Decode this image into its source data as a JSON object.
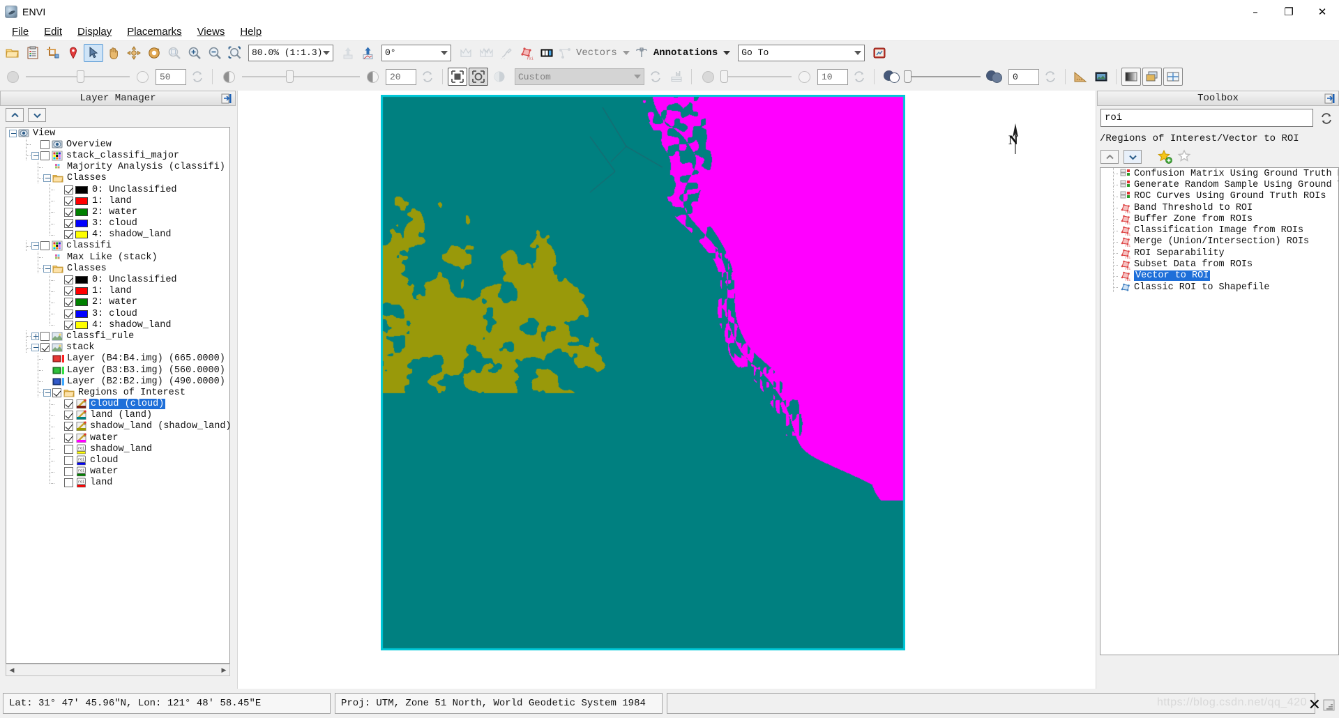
{
  "window": {
    "title": "ENVI",
    "app_icon": "envi-logo-icon",
    "minimize": "–",
    "maximize": "❐",
    "close": "✕"
  },
  "menubar": {
    "items": [
      {
        "label": "File",
        "mnemonic": "F"
      },
      {
        "label": "Edit",
        "mnemonic": "E"
      },
      {
        "label": "Display",
        "mnemonic": "D"
      },
      {
        "label": "Placemarks",
        "mnemonic": "P"
      },
      {
        "label": "Views",
        "mnemonic": "V"
      },
      {
        "label": "Help",
        "mnemonic": "H"
      }
    ]
  },
  "toolbar_main": {
    "buttons": [
      {
        "name": "open-file-icon",
        "tip": "Open"
      },
      {
        "name": "clipboard-icon",
        "tip": "Data Manager"
      },
      {
        "name": "crop-image-icon",
        "tip": "Subset"
      },
      {
        "name": "placemark-pin-icon",
        "tip": "Placemark"
      },
      {
        "name": "select-arrow-icon",
        "tip": "Select",
        "active": true
      },
      {
        "name": "pan-hand-icon",
        "tip": "Pan"
      },
      {
        "name": "fly-icon",
        "tip": "Fly"
      },
      {
        "name": "rotate-icon",
        "tip": "Rotate"
      },
      {
        "name": "zoom-to-fit-icon",
        "tip": "Zoom to fit"
      },
      {
        "name": "zoom-in-icon",
        "tip": "Zoom In"
      },
      {
        "name": "zoom-out-icon",
        "tip": "Zoom Out"
      },
      {
        "name": "zoom-region-icon",
        "tip": "Zoom to Region"
      }
    ],
    "zoom_combo": "80.0% (1:1.3)",
    "rotation_combo": "0°",
    "north_up_icon": "north-up-icon",
    "rotate-reset-icon": "rotate-reset-icon",
    "after_rotate_buttons": [
      {
        "name": "crown-icon",
        "tip": "Crosshairs"
      },
      {
        "name": "multi-crown-icon",
        "tip": "Multi Crosshairs"
      },
      {
        "name": "cursor-value-icon",
        "tip": "Cursor Value"
      },
      {
        "name": "region-of-interest-icon",
        "tip": "Region of Interest"
      },
      {
        "name": "pixel-readout-icon",
        "tip": "Pixel Readout"
      }
    ],
    "vectors_label": "Vectors",
    "vectors_icon": "vectors-icon",
    "annotations_label": "Annotations",
    "annotations_icon": "annotations-icon",
    "goto_placeholder": "Go To",
    "goto_value": "Go To",
    "goto_button_icon": "goto-target-icon"
  },
  "toolbar_secondary": {
    "transparency_value": "50",
    "transparency_reset_icon": "reset-icon",
    "brightness_value": "20",
    "brightness_reset_icon": "reset-icon",
    "stretch_combo": "Custom",
    "stretch_reset_icon": "reset-icon",
    "histogram_icon": "histogram-icon",
    "contrast_value": "10",
    "contrast_reset_icon": "reset-icon",
    "sharpen_value": "0",
    "sharpen_reset_icon": "reset-icon",
    "ruler_icon": "ruler-icon",
    "filmstrip_icon": "filmstrip-icon",
    "portal_buttons": [
      {
        "name": "grayscale-portal-icon"
      },
      {
        "name": "blend-portal-icon"
      },
      {
        "name": "flicker-portal-icon"
      }
    ],
    "fit_icons": [
      {
        "name": "fit-to-window-icon"
      },
      {
        "name": "fit-to-selection-icon"
      },
      {
        "name": "reload-view-icon"
      }
    ]
  },
  "layer_manager": {
    "title": "Layer Manager",
    "pin_icon": "pin-panel-icon",
    "move_up_icon": "chevron-up-icon",
    "move_down_icon": "chevron-down-icon",
    "scroll_left_icon": "chevron-left-icon",
    "scroll_right_icon": "chevron-right-icon",
    "tree": [
      {
        "id": "view",
        "label": "View",
        "indent": 0,
        "expander": "minus",
        "checkbox": null,
        "icon": "view-eye-icon",
        "guide": "none"
      },
      {
        "id": "overview",
        "label": "Overview",
        "indent": 1,
        "expander": null,
        "checkbox": "off",
        "icon": "view-eye-icon",
        "guide": "tee"
      },
      {
        "id": "stack_classifi_major",
        "label": "stack_classifi_major",
        "indent": 1,
        "expander": "minus",
        "checkbox": "off",
        "icon": "classification-icon",
        "guide": "tee"
      },
      {
        "id": "majority_analysis",
        "label": "Majority Analysis (classifi)",
        "indent": 2,
        "expander": null,
        "checkbox": null,
        "icon": "classification-small-icon",
        "guide": "tee"
      },
      {
        "id": "classes_1",
        "label": "Classes",
        "indent": 2,
        "expander": "minus",
        "checkbox": null,
        "icon": "folder-icon",
        "guide": "tee"
      },
      {
        "id": "c1_0",
        "label": "0: Unclassified",
        "indent": 3,
        "expander": null,
        "checkbox": "on",
        "swatch": "#000000",
        "guide": "tee"
      },
      {
        "id": "c1_1",
        "label": "1: land",
        "indent": 3,
        "expander": null,
        "checkbox": "on",
        "swatch": "#ff0000",
        "guide": "tee"
      },
      {
        "id": "c1_2",
        "label": "2: water",
        "indent": 3,
        "expander": null,
        "checkbox": "on",
        "swatch": "#008000",
        "guide": "tee"
      },
      {
        "id": "c1_3",
        "label": "3: cloud",
        "indent": 3,
        "expander": null,
        "checkbox": "on",
        "swatch": "#0000ff",
        "guide": "tee"
      },
      {
        "id": "c1_4",
        "label": "4: shadow_land",
        "indent": 3,
        "expander": null,
        "checkbox": "on",
        "swatch": "#ffff00",
        "guide": "ell"
      },
      {
        "id": "classifi",
        "label": "classifi",
        "indent": 1,
        "expander": "minus",
        "checkbox": "off",
        "icon": "classification-icon",
        "guide": "tee"
      },
      {
        "id": "maxlike",
        "label": "Max Like (stack)",
        "indent": 2,
        "expander": null,
        "checkbox": null,
        "icon": "classification-small-icon",
        "guide": "tee"
      },
      {
        "id": "classes_2",
        "label": "Classes",
        "indent": 2,
        "expander": "minus",
        "checkbox": null,
        "icon": "folder-icon",
        "guide": "tee"
      },
      {
        "id": "c2_0",
        "label": "0: Unclassified",
        "indent": 3,
        "expander": null,
        "checkbox": "on",
        "swatch": "#000000",
        "guide": "tee"
      },
      {
        "id": "c2_1",
        "label": "1: land",
        "indent": 3,
        "expander": null,
        "checkbox": "on",
        "swatch": "#ff0000",
        "guide": "tee"
      },
      {
        "id": "c2_2",
        "label": "2: water",
        "indent": 3,
        "expander": null,
        "checkbox": "on",
        "swatch": "#008000",
        "guide": "tee"
      },
      {
        "id": "c2_3",
        "label": "3: cloud",
        "indent": 3,
        "expander": null,
        "checkbox": "on",
        "swatch": "#0000ff",
        "guide": "tee"
      },
      {
        "id": "c2_4",
        "label": "4: shadow_land",
        "indent": 3,
        "expander": null,
        "checkbox": "on",
        "swatch": "#ffff00",
        "guide": "ell"
      },
      {
        "id": "classfi_rule",
        "label": "classfi_rule",
        "indent": 1,
        "expander": "plus",
        "checkbox": "off",
        "icon": "raster-icon",
        "guide": "tee"
      },
      {
        "id": "stack",
        "label": "stack",
        "indent": 1,
        "expander": "minus",
        "checkbox": "on",
        "icon": "raster-icon",
        "guide": "tee"
      },
      {
        "id": "band_b4",
        "label": "Layer (B4:B4.img) (665.0000)",
        "indent": 2,
        "expander": null,
        "checkbox": null,
        "icon": "band-red-icon",
        "guide": "tee"
      },
      {
        "id": "band_b3",
        "label": "Layer (B3:B3.img) (560.0000)",
        "indent": 2,
        "expander": null,
        "checkbox": null,
        "icon": "band-green-icon",
        "guide": "tee"
      },
      {
        "id": "band_b2",
        "label": "Layer (B2:B2.img) (490.0000)",
        "indent": 2,
        "expander": null,
        "checkbox": null,
        "icon": "band-blue-icon",
        "guide": "tee"
      },
      {
        "id": "roi_folder",
        "label": "Regions of Interest",
        "indent": 2,
        "expander": "minus",
        "checkbox": "on",
        "icon": "folder-icon",
        "guide": "tee"
      },
      {
        "id": "roi_cloud_v",
        "label": "cloud (cloud)",
        "indent": 3,
        "expander": null,
        "checkbox": "on",
        "icon": "roi-vector-icon",
        "icon_color": "#7b1f12",
        "selected": true,
        "guide": "tee"
      },
      {
        "id": "roi_land_v",
        "label": "land (land)",
        "indent": 3,
        "expander": null,
        "checkbox": "on",
        "icon": "roi-vector-icon",
        "icon_color": "#008080",
        "guide": "tee"
      },
      {
        "id": "roi_shadow_v",
        "label": "shadow_land (shadow_land)",
        "indent": 3,
        "expander": null,
        "checkbox": "on",
        "icon": "roi-vector-icon",
        "icon_color": "#9a9a00",
        "guide": "tee"
      },
      {
        "id": "roi_water_v",
        "label": "water",
        "indent": 3,
        "expander": null,
        "checkbox": "on",
        "icon": "roi-vector-icon",
        "icon_color": "#ff00ff",
        "guide": "tee"
      },
      {
        "id": "roi_shadow",
        "label": "shadow_land",
        "indent": 3,
        "expander": null,
        "checkbox": "off",
        "icon": "roi-icon",
        "icon_color": "#ffff00",
        "guide": "tee"
      },
      {
        "id": "roi_cloud",
        "label": "cloud",
        "indent": 3,
        "expander": null,
        "checkbox": "off",
        "icon": "roi-icon",
        "icon_color": "#0000ff",
        "guide": "tee"
      },
      {
        "id": "roi_water",
        "label": "water",
        "indent": 3,
        "expander": null,
        "checkbox": "off",
        "icon": "roi-icon",
        "icon_color": "#008000",
        "guide": "tee"
      },
      {
        "id": "roi_land",
        "label": "land",
        "indent": 3,
        "expander": null,
        "checkbox": "off",
        "icon": "roi-icon",
        "icon_color": "#ff0000",
        "guide": "ell"
      }
    ]
  },
  "toolbox": {
    "title": "Toolbox",
    "pin_icon": "pin-panel-icon",
    "search_value": "roi",
    "search_placeholder": "Search",
    "refresh_icon": "refresh-icon",
    "path": "/Regions of Interest/Vector to ROI",
    "move_up_icon": "chevron-up-icon",
    "move_down_icon": "chevron-down-icon",
    "add_favorite_icon": "star-add-icon",
    "remove_favorite_icon": "star-remove-icon",
    "items": [
      {
        "label": "Confusion Matrix Using Ground Truth ROI",
        "icon": "matrix-icon"
      },
      {
        "label": "Generate Random Sample Using Ground Tr",
        "icon": "matrix-icon"
      },
      {
        "label": "ROC Curves Using Ground Truth ROIs",
        "icon": "matrix-icon"
      },
      {
        "label": "Band Threshold to ROI",
        "icon": "roi-tool-icon"
      },
      {
        "label": "Buffer Zone from ROIs",
        "icon": "roi-tool-icon"
      },
      {
        "label": "Classification Image from ROIs",
        "icon": "roi-tool-icon"
      },
      {
        "label": "Merge (Union/Intersection) ROIs",
        "icon": "roi-tool-icon"
      },
      {
        "label": "ROI Separability",
        "icon": "roi-tool-icon"
      },
      {
        "label": "Subset Data from ROIs",
        "icon": "roi-tool-icon"
      },
      {
        "label": "Vector to ROI",
        "icon": "roi-tool-icon",
        "selected": true
      },
      {
        "label": "Classic ROI to Shapefile",
        "icon": "shapefile-icon"
      }
    ]
  },
  "view": {
    "north_arrow_label": "N",
    "classes": {
      "water": "#008080",
      "land": "#8b1a0a",
      "shadow_land": "#99990a",
      "cloud": "#ff00ff",
      "border": "#00c8d8"
    }
  },
  "statusbar": {
    "coordinates": "Lat: 31° 47′ 45.96″N, Lon: 121° 48′ 58.45″E",
    "projection": "Proj: UTM, Zone 51 North, World Geodetic System 1984",
    "message": "",
    "watermark": "https://blog.csdn.net/qq_420",
    "cancel_icon": "close-icon",
    "resize_grip_icon": "resize-grip-icon"
  }
}
